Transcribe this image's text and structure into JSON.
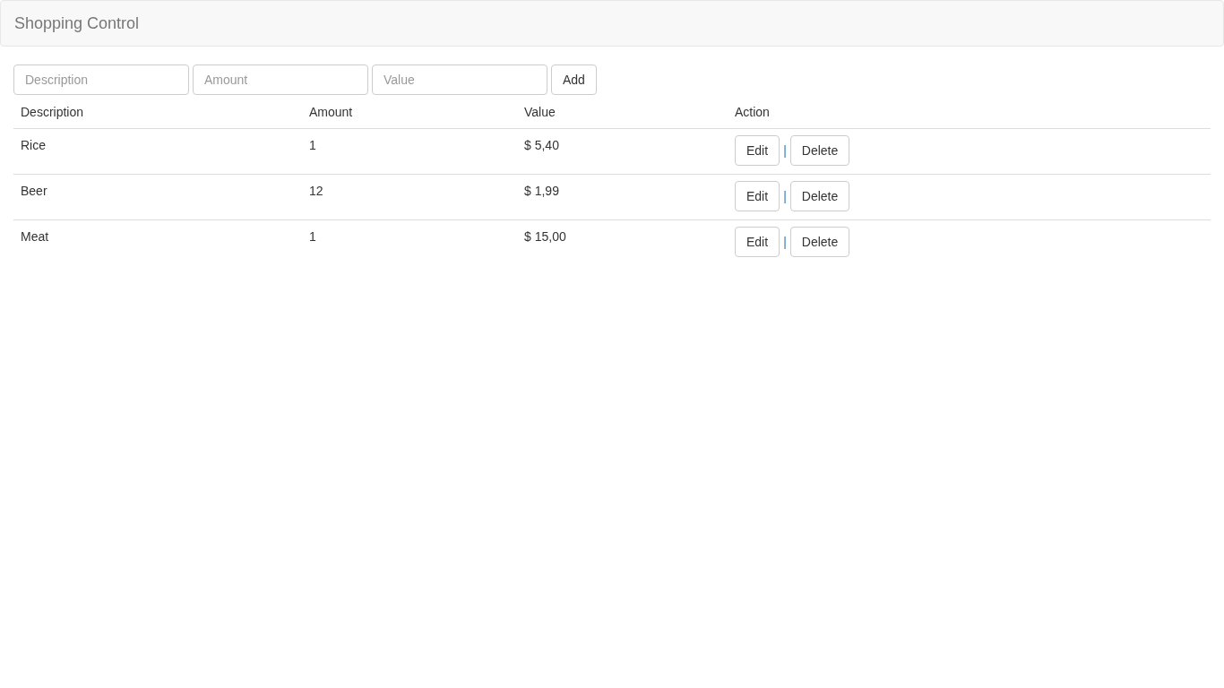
{
  "navbar": {
    "title": "Shopping Control"
  },
  "form": {
    "fields": [
      {
        "placeholder": "Description"
      },
      {
        "placeholder": "Amount"
      },
      {
        "placeholder": "Value"
      }
    ],
    "button": "Add"
  },
  "table": {
    "columns": [
      "Description",
      "Amount",
      "Value",
      "Action"
    ],
    "rows": [
      {
        "description": "Rice",
        "amount": "1",
        "value": "$ 5,40",
        "actions": [
          "Edit",
          "|",
          "Delete"
        ]
      },
      {
        "description": "Beer",
        "amount": "12",
        "value": "$ 1,99",
        "actions": [
          "Edit",
          "|",
          "Delete"
        ]
      },
      {
        "description": "Meat",
        "amount": "1",
        "value": "$ 15,00",
        "actions": [
          "Edit",
          "|",
          "Delete"
        ]
      }
    ]
  }
}
